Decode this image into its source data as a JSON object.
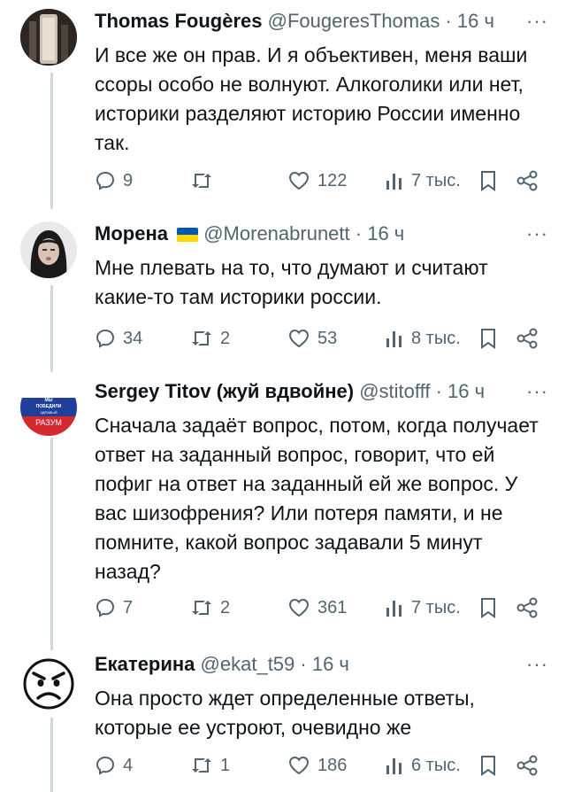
{
  "tweets": [
    {
      "name": "Thomas Fougères",
      "handle": "@FougeresThomas",
      "time": "16 ч",
      "text_lines": [
        "И все же он прав. И я объективен, меня ваши",
        "ссоры особо не волнуют. Алкоголики или нет,",
        "историки разделяют историю России именно",
        "так."
      ],
      "replies": "9",
      "retweets": "",
      "likes": "122",
      "views": "7 тыс."
    },
    {
      "name": "Морена",
      "handle": "@Morenabrunett",
      "time": "16 ч",
      "text_lines": [
        "Мне плевать на то, что думают и считают",
        "какие-то там историки россии."
      ],
      "replies": "34",
      "retweets": "2",
      "likes": "53",
      "views": "8 тыс."
    },
    {
      "name": "Sergey Titov (жуй вдвойне)",
      "handle": "@stitofff",
      "time": "16 ч",
      "avatar_text": [
        "МЫ",
        "ПОБЕДИЛИ",
        "ЗДРАВЫЙ",
        "РАЗУМ"
      ],
      "text_lines": [
        "Сначала задаёт вопрос, потом, когда получает",
        "ответ на заданный вопрос, говорит, что ей",
        "пофиг на ответ на заданный ей же вопрос. У",
        "вас шизофрения? Или потеря памяти, и не",
        "помните, какой вопрос задавали 5 минут",
        "назад?"
      ],
      "replies": "7",
      "retweets": "2",
      "likes": "361",
      "views": "7 тыс."
    },
    {
      "name": "Екатерина",
      "handle": "@ekat_t59",
      "time": "16 ч",
      "text_lines": [
        "Она просто ждет определенные ответы,",
        "которые ее устроют, очевидно же"
      ],
      "replies": "4",
      "retweets": "1",
      "likes": "186",
      "views": "6 тыс."
    }
  ],
  "more_label": "···",
  "separator": " · ",
  "colors": {
    "text": "#0f1419",
    "muted": "#536471",
    "line": "#cfd9de",
    "flag_blue": "#0057b7",
    "flag_yellow": "#ffd700"
  }
}
